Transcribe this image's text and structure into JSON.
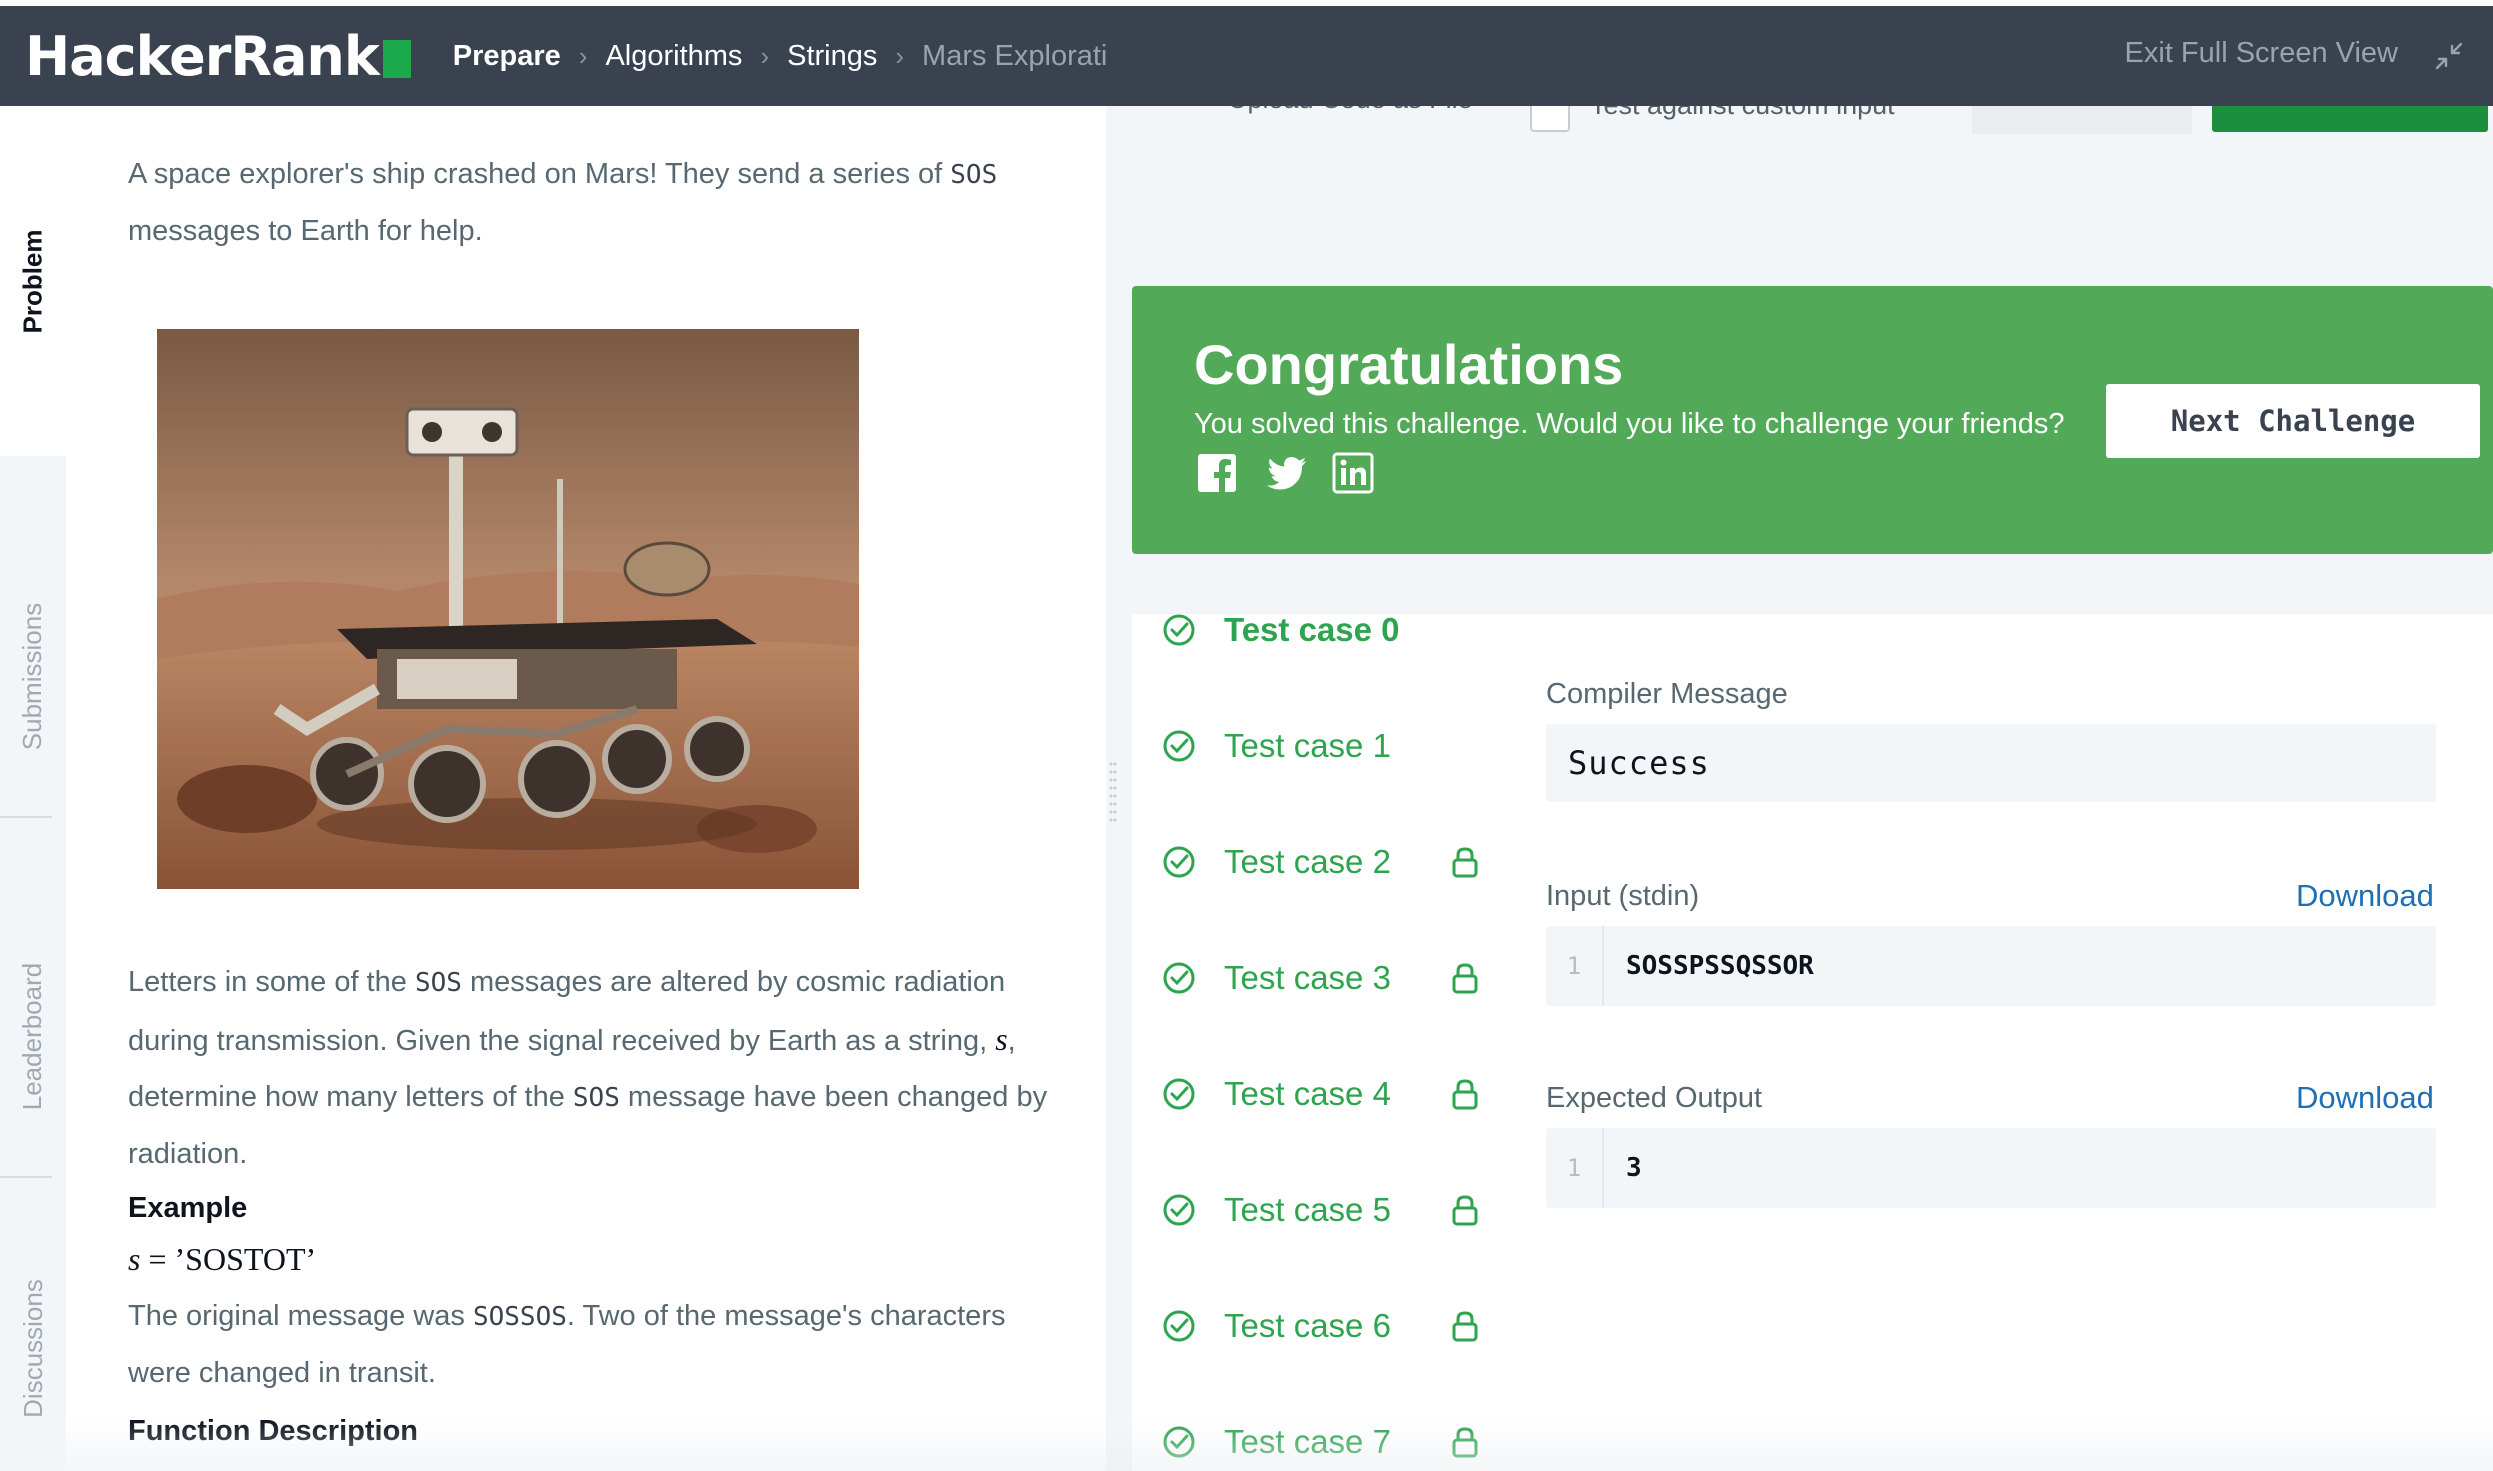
{
  "header": {
    "logo_text": "HackerRank",
    "breadcrumbs": [
      "Prepare",
      "Algorithms",
      "Strings",
      "Mars Exploration"
    ],
    "exit_label": "Exit Full Screen View",
    "colors": {
      "bar": "#39424e",
      "brand_green": "#1ba94c"
    }
  },
  "sidebar": {
    "tabs": [
      {
        "label": "Problem",
        "active": true
      },
      {
        "label": "Submissions",
        "active": false
      },
      {
        "label": "Leaderboard",
        "active": false
      },
      {
        "label": "Discussions",
        "active": false
      }
    ]
  },
  "problem": {
    "intro_1": "A space explorer's ship crashed on Mars! They send a series of ",
    "intro_code": "SOS",
    "intro_2": " messages to Earth for help.",
    "p2_1": "Letters in some of the ",
    "p2_code1": "SOS",
    "p2_2": " messages are altered by cosmic radiation during transmission. Given the signal received by Earth as a string, ",
    "p2_var": "s",
    "p2_3": ", determine how many letters of the ",
    "p2_code2": "SOS",
    "p2_4": " message have been changed by radiation.",
    "example_heading": "Example",
    "example_var": "s",
    "example_eq": " = ",
    "example_val": "’SOSTOT’",
    "p3_1": "The original message was ",
    "p3_code": "SOSSOS",
    "p3_2": ". Two of the message's characters were changed in transit.",
    "function_heading": "Function Description"
  },
  "editor_toolbar": {
    "upload_label": "Upload Code as File",
    "custom_input_label": "Test against custom input"
  },
  "congrats": {
    "title": "Congratulations",
    "subtitle": "You solved this challenge. Would you like to challenge your friends?",
    "next_button": "Next Challenge",
    "social": [
      "facebook-icon",
      "twitter-icon",
      "linkedin-icon"
    ],
    "color": "#52a958"
  },
  "results": {
    "test_cases": [
      {
        "label": "Test case 0",
        "active": true,
        "locked": false
      },
      {
        "label": "Test case 1",
        "active": false,
        "locked": false
      },
      {
        "label": "Test case 2",
        "active": false,
        "locked": true
      },
      {
        "label": "Test case 3",
        "active": false,
        "locked": true
      },
      {
        "label": "Test case 4",
        "active": false,
        "locked": true
      },
      {
        "label": "Test case 5",
        "active": false,
        "locked": true
      },
      {
        "label": "Test case 6",
        "active": false,
        "locked": true
      },
      {
        "label": "Test case 7",
        "active": false,
        "locked": true
      }
    ],
    "compiler_label": "Compiler Message",
    "compiler_value": "Success",
    "input_label": "Input (stdin)",
    "input_line_no": "1",
    "input_value": "SOSSPSSQSSOR",
    "expected_label": "Expected Output",
    "expected_line_no": "1",
    "expected_value": "3",
    "download_label": "Download"
  }
}
